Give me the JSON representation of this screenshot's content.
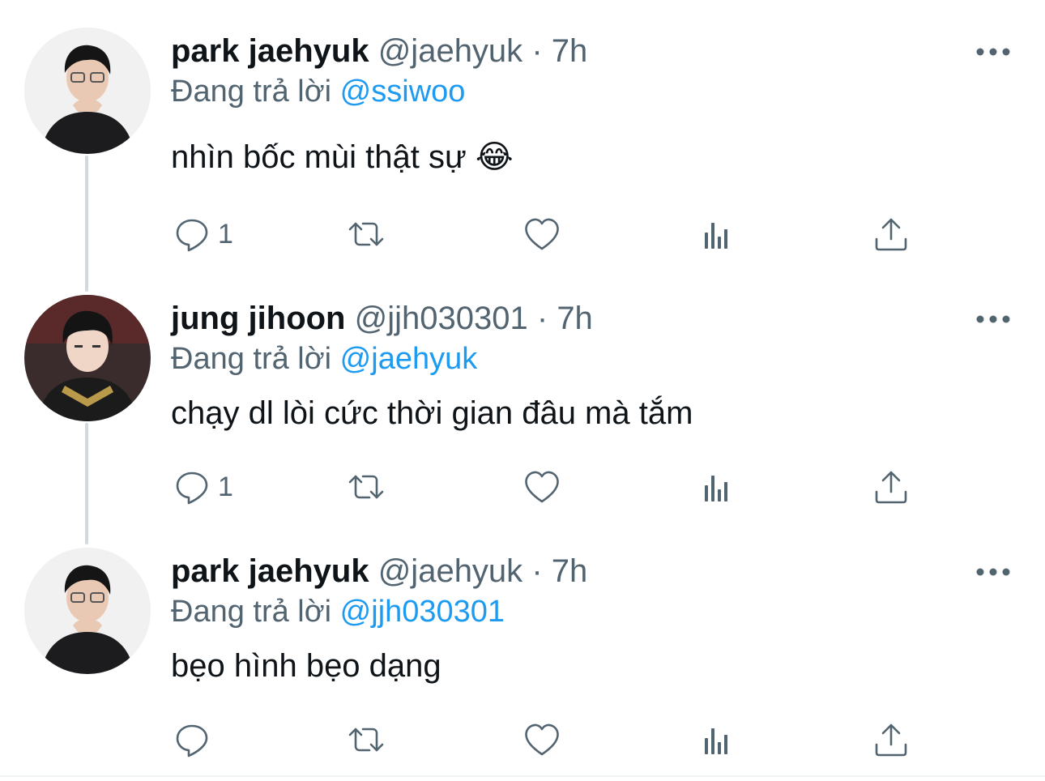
{
  "colors": {
    "link": "#1d9bf0",
    "secondary": "#536471",
    "text": "#0f1419",
    "thread_line": "#cfd9de"
  },
  "tweets": [
    {
      "name": "park jaehyuk",
      "handle": "@jaehyuk",
      "sep": "·",
      "time": "7h",
      "reply_label": "Đang trả lời",
      "reply_mention": "@ssiwoo",
      "text": "nhìn bốc mùi thật sự 😂",
      "reply_count": "1",
      "icons": [
        "reply-icon",
        "retweet-icon",
        "like-icon",
        "analytics-icon",
        "share-icon",
        "more-icon"
      ]
    },
    {
      "name": "jung jihoon",
      "handle": "@jjh030301",
      "sep": "·",
      "time": "7h",
      "reply_label": "Đang trả lời",
      "reply_mention": "@jaehyuk",
      "text": "chạy dl lòi cức thời gian đâu mà tắm",
      "reply_count": "1",
      "icons": [
        "reply-icon",
        "retweet-icon",
        "like-icon",
        "analytics-icon",
        "share-icon",
        "more-icon"
      ]
    },
    {
      "name": "park jaehyuk",
      "handle": "@jaehyuk",
      "sep": "·",
      "time": "7h",
      "reply_label": "Đang trả lời",
      "reply_mention": "@jjh030301",
      "text": "bẹo hình bẹo dạng",
      "reply_count": "",
      "icons": [
        "reply-icon",
        "retweet-icon",
        "like-icon",
        "analytics-icon",
        "share-icon",
        "more-icon"
      ]
    }
  ]
}
